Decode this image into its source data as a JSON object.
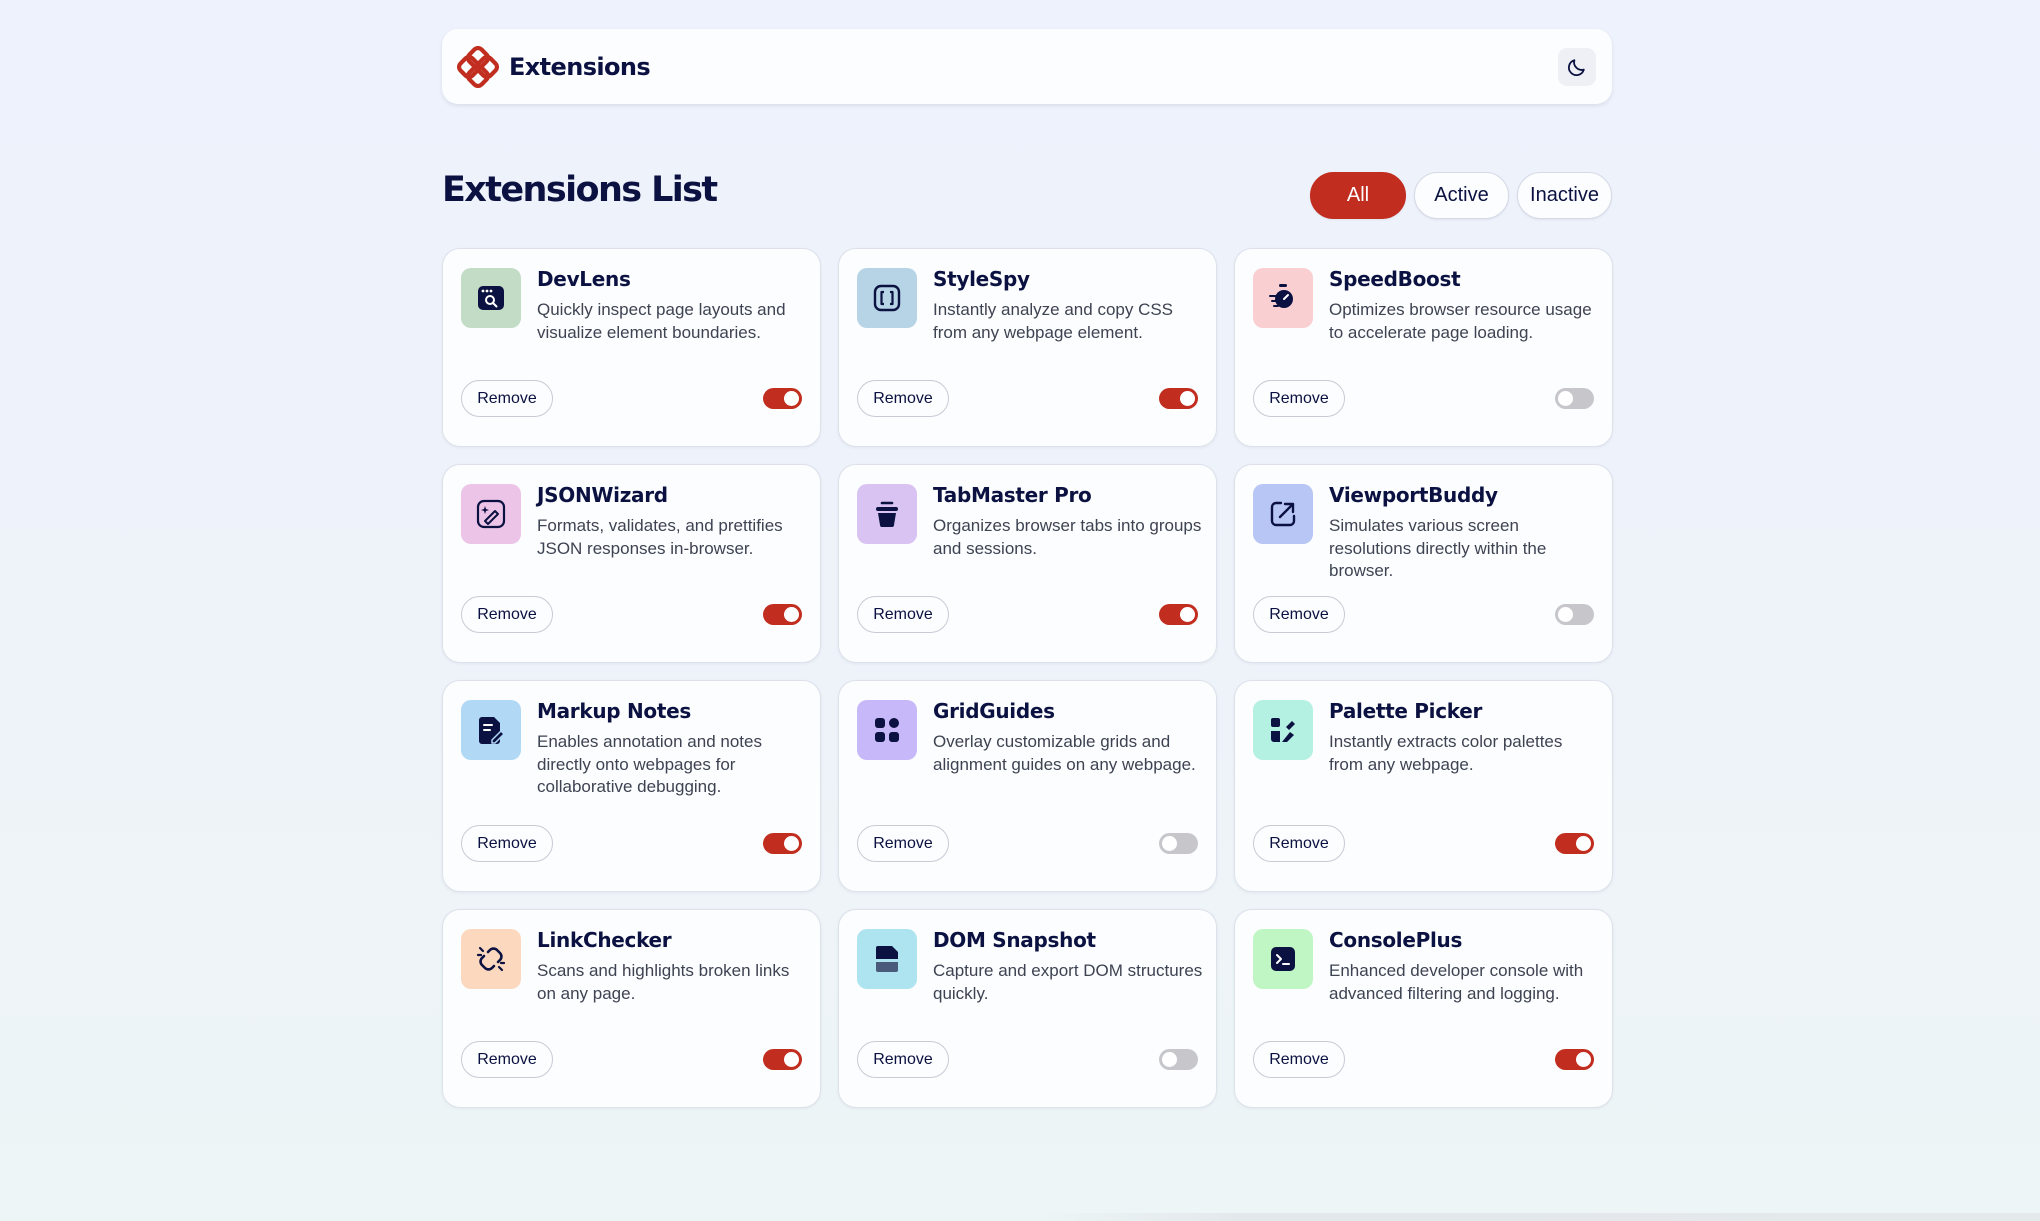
{
  "header": {
    "app_name": "Extensions",
    "logo_icon": "extensions-logo-icon",
    "theme_toggle_icon": "moon-icon"
  },
  "title": "Extensions List",
  "filters": [
    {
      "label": "All",
      "selected": true
    },
    {
      "label": "Active",
      "selected": false
    },
    {
      "label": "Inactive",
      "selected": false
    }
  ],
  "colors": {
    "accent": "#c12d1f",
    "text": "#0b1140",
    "toggle_off": "#c7c7cb"
  },
  "extensions": [
    {
      "name": "DevLens",
      "description": "Quickly inspect page layouts and visualize element boundaries.",
      "remove_label": "Remove",
      "active": true,
      "icon": "browser-search-icon",
      "icon_bg": "#c3dcc6"
    },
    {
      "name": "StyleSpy",
      "description": "Instantly analyze and copy CSS from any webpage element.",
      "remove_label": "Remove",
      "active": true,
      "icon": "code-brackets-icon",
      "icon_bg": "#b6d4e6"
    },
    {
      "name": "SpeedBoost",
      "description": "Optimizes browser resource usage to accelerate page loading.",
      "remove_label": "Remove",
      "active": false,
      "icon": "stopwatch-icon",
      "icon_bg": "#f9cfd2"
    },
    {
      "name": "JSONWizard",
      "description": "Formats, validates, and prettifies JSON responses in-browser.",
      "remove_label": "Remove",
      "active": true,
      "icon": "magic-wand-icon",
      "icon_bg": "#ecc4e8"
    },
    {
      "name": "TabMaster Pro",
      "description": "Organizes browser tabs into groups and sessions.",
      "remove_label": "Remove",
      "active": true,
      "icon": "bucket-icon",
      "icon_bg": "#d9c3f2"
    },
    {
      "name": "ViewportBuddy",
      "description": "Simulates various screen resolutions directly within the browser.",
      "remove_label": "Remove",
      "active": false,
      "icon": "resize-arrow-icon",
      "icon_bg": "#b7c6f4"
    },
    {
      "name": "Markup Notes",
      "description": "Enables annotation and notes directly onto webpages for collaborative debugging.",
      "remove_label": "Remove",
      "active": true,
      "icon": "note-pen-icon",
      "icon_bg": "#b1d8f4"
    },
    {
      "name": "GridGuides",
      "description": "Overlay customizable grids and alignment guides on any webpage.",
      "remove_label": "Remove",
      "active": false,
      "icon": "grid-blocks-icon",
      "icon_bg": "#c7b8fa"
    },
    {
      "name": "Palette Picker",
      "description": "Instantly extracts color palettes from any webpage.",
      "remove_label": "Remove",
      "active": true,
      "icon": "palette-icon",
      "icon_bg": "#b4f1e2"
    },
    {
      "name": "LinkChecker",
      "description": "Scans and highlights broken links on any page.",
      "remove_label": "Remove",
      "active": true,
      "icon": "broken-link-icon",
      "icon_bg": "#fbd8be"
    },
    {
      "name": "DOM Snapshot",
      "description": "Capture and export DOM structures quickly.",
      "remove_label": "Remove",
      "active": false,
      "icon": "document-snapshot-icon",
      "icon_bg": "#aee4ef"
    },
    {
      "name": "ConsolePlus",
      "description": "Enhanced developer console with advanced filtering and logging.",
      "remove_label": "Remove",
      "active": true,
      "icon": "terminal-icon",
      "icon_bg": "#bff6c4"
    }
  ]
}
